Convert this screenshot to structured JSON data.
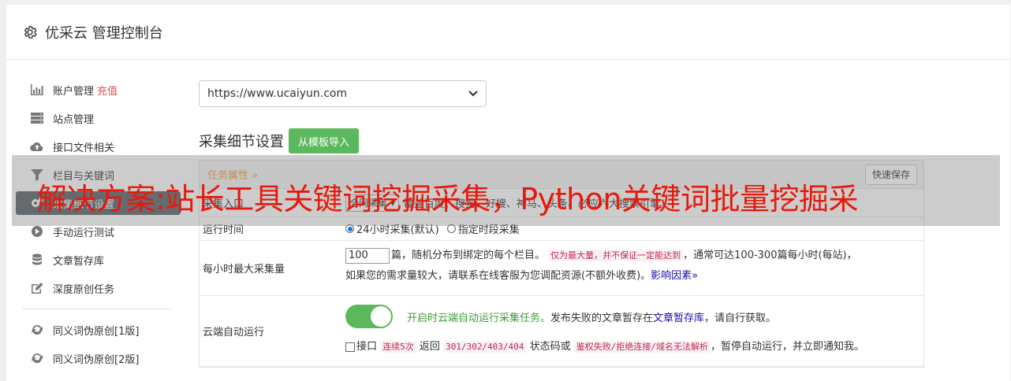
{
  "header": {
    "title": "优采云 管理控制台",
    "icon": "gear-icon"
  },
  "sidebar": {
    "items": [
      {
        "label": "账户管理",
        "badge": "充值",
        "icon": "bar-chart-icon"
      },
      {
        "label": "站点管理",
        "icon": "server-icon"
      },
      {
        "label": "接口文件相关",
        "icon": "cloud-upload-icon"
      },
      {
        "label": "栏目与关键词",
        "icon": "filter-icon"
      },
      {
        "label": "采集细节设置",
        "icon": "gears-icon"
      },
      {
        "label": "手动运行测试",
        "icon": "play-circle-icon"
      },
      {
        "label": "文章暂存库",
        "icon": "database-icon"
      },
      {
        "label": "深度原创任务",
        "icon": "edit-icon"
      },
      {
        "label": "同义词伪原创[1版]",
        "icon": "refresh-icon"
      },
      {
        "label": "同义词伪原创[2版]",
        "icon": "refresh-icon"
      }
    ]
  },
  "main": {
    "site_select_value": "https://www.ucaiyun.com",
    "section_title": "采集细节设置",
    "import_button": "从模板导入",
    "panel_tab": "任务属性 »",
    "quick_save": "快速保存",
    "rows": {
      "entry": {
        "label": "采集入口",
        "select": "全网采集",
        "text": "覆盖百度、搜狗、好搜、神马、头条、必应六大搜索引擎。"
      },
      "runtime": {
        "label": "运行时间",
        "opt1": "24小时采集(默认)",
        "opt2": "指定时段采集"
      },
      "max": {
        "label": "每小时最大采集量",
        "value": "100",
        "text1": "篇，随机分布到绑定的每个栏目。",
        "code": "仅为最大量，并不保证一定能达到",
        "text2": "，通常可达100-300篇每小时(每站)，",
        "text3": "如果您的需求量较大，请联系在线客服为您调配资源(不额外收费)。",
        "link": "影响因素»"
      },
      "cloud": {
        "label": "云端自动运行",
        "green_text": "开启时云端自动运行采集任务。",
        "text1": "发布失败的文章暂存在",
        "link": "文章暂存库",
        "text2": "，请自行获取。",
        "check_label": "接口",
        "code1": "连续5次",
        "text3": "返回",
        "code2": "301/302/403/404",
        "text4": "状态码或",
        "code3": "鉴权失败/拒绝连接/域名无法解析",
        "text5": "，暂停自动运行，并立即通知我。"
      }
    }
  },
  "overlay": {
    "text": "解决方案:站长工具关键词挖掘采集，Python关键词批量挖掘采"
  },
  "colors": {
    "accent_green": "#5cb85c",
    "active_sidebar": "#5a6268",
    "overlay_text": "#e8190b"
  }
}
